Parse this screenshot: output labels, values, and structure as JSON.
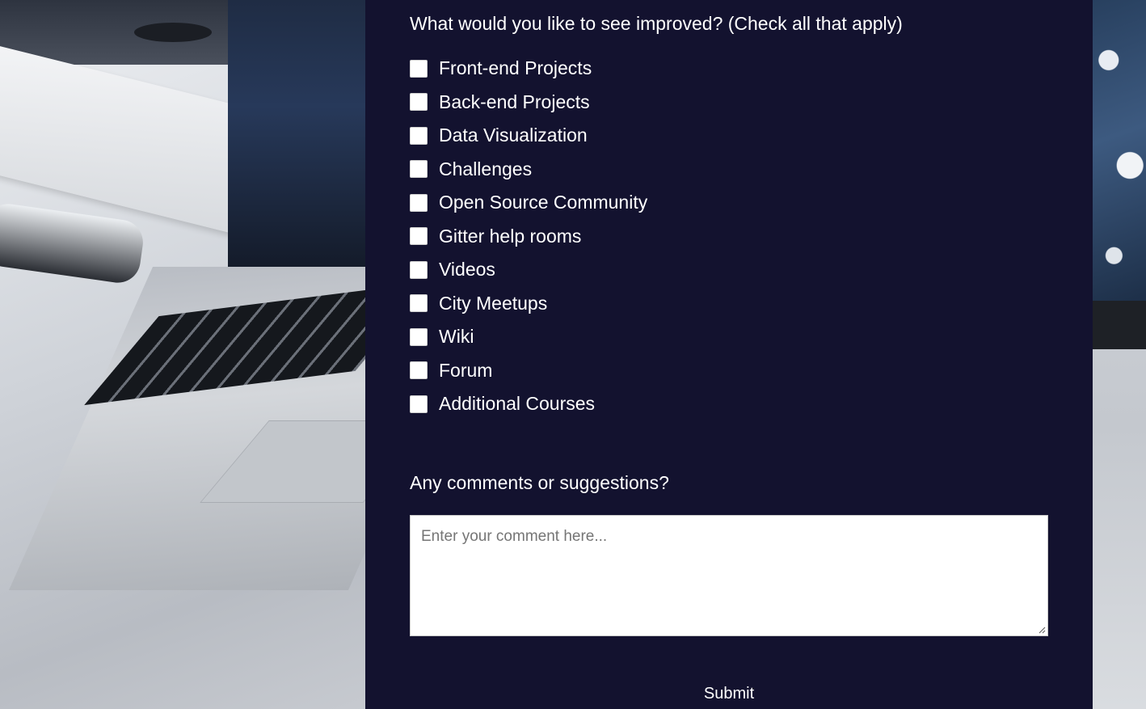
{
  "survey": {
    "improvement_question": "What would you like to see improved? (Check all that apply)",
    "improvement_options": [
      {
        "label": "Front-end Projects",
        "checked": false
      },
      {
        "label": "Back-end Projects",
        "checked": false
      },
      {
        "label": "Data Visualization",
        "checked": false
      },
      {
        "label": "Challenges",
        "checked": false
      },
      {
        "label": "Open Source Community",
        "checked": false
      },
      {
        "label": "Gitter help rooms",
        "checked": false
      },
      {
        "label": "Videos",
        "checked": false
      },
      {
        "label": "City Meetups",
        "checked": false
      },
      {
        "label": "Wiki",
        "checked": false
      },
      {
        "label": "Forum",
        "checked": false
      },
      {
        "label": "Additional Courses",
        "checked": false
      }
    ],
    "comments_label": "Any comments or suggestions?",
    "comments_placeholder": "Enter your comment here...",
    "comments_value": "",
    "submit_label": "Submit"
  },
  "colors": {
    "panel_background": "#13122f",
    "text": "#ffffff",
    "placeholder": "#757575"
  },
  "icons": {
    "textarea_resize": "resize-grip-icon"
  }
}
